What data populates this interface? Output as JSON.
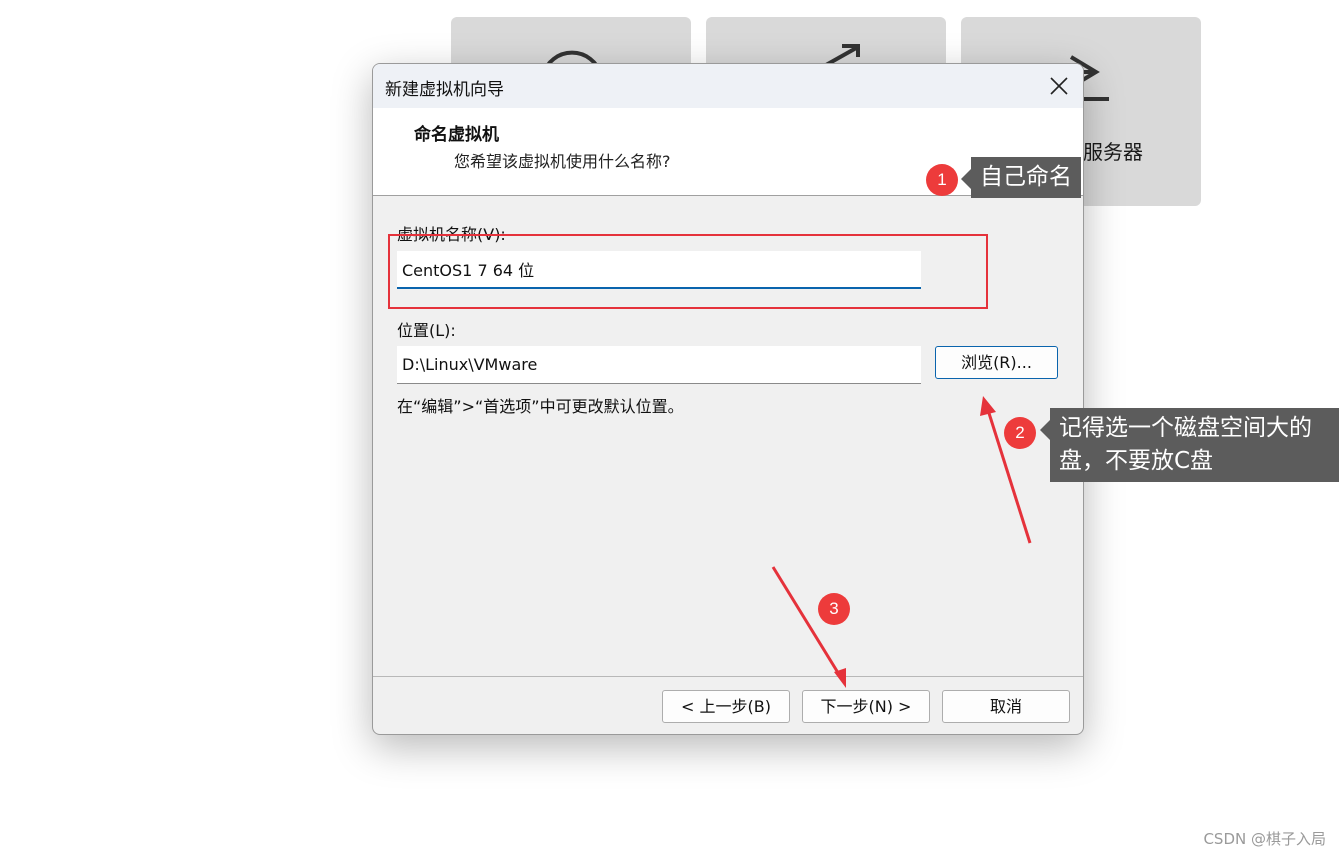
{
  "background": {
    "tile3_label": "程服务器"
  },
  "dialog": {
    "title": "新建虚拟机向导",
    "header_title": "命名虚拟机",
    "header_subtitle": "您希望该虚拟机使用什么名称?",
    "name_label": "虚拟机名称(V):",
    "name_value": "CentOS1 7 64 位",
    "location_label": "位置(L):",
    "location_value": "D:\\Linux\\VMware",
    "browse_label": "浏览(R)...",
    "hint": "在“编辑”>“首选项”中可更改默认位置。",
    "back_label": "< 上一步(B)",
    "next_label": "下一步(N) >",
    "cancel_label": "取消"
  },
  "annotations": {
    "badge1": "1",
    "callout1": "自己命名",
    "badge2": "2",
    "callout2_line1": "记得选一个磁盘空间大的",
    "callout2_line2": "盘，不要放C盘",
    "badge3": "3",
    "color_red": "#e5323b",
    "color_callout": "#5c5c5c"
  },
  "watermark": "CSDN @棋子入局",
  "icons": [
    "close-icon",
    "arrow-icon"
  ]
}
